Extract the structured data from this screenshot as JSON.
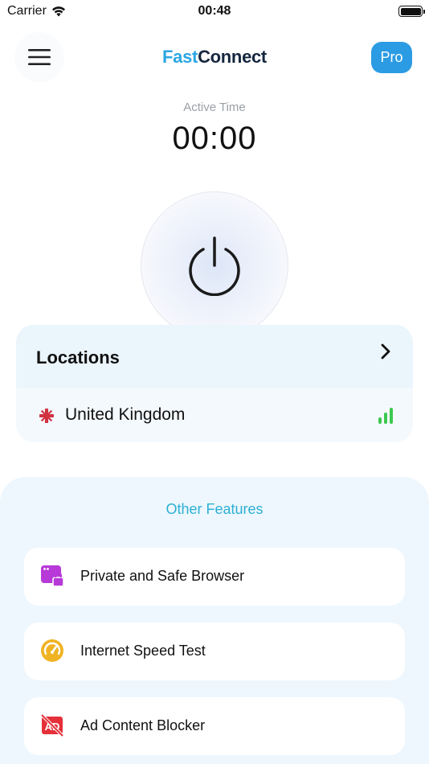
{
  "status_bar": {
    "carrier": "Carrier",
    "time": "00:48"
  },
  "header": {
    "brand_part1": "Fast",
    "brand_part2": "Connect",
    "pro_label": "Pro"
  },
  "timer": {
    "label": "Active Time",
    "value": "00:00"
  },
  "locations": {
    "title": "Locations",
    "selected": "United Kingdom",
    "signal_bars": 3
  },
  "features": {
    "title": "Other Features",
    "items": [
      {
        "label": "Private and Safe Browser",
        "icon": "private-browser-icon",
        "color": "#b73ad8"
      },
      {
        "label": "Internet Speed Test",
        "icon": "speedometer-icon",
        "color": "#f0b323"
      },
      {
        "label": "Ad Content Blocker",
        "icon": "ad-block-icon",
        "color": "#e5303a"
      }
    ]
  },
  "colors": {
    "accent": "#2b9be4",
    "brand_blue": "#2aa6e2",
    "brand_dark": "#15263f",
    "signal": "#3cc84f",
    "features_title": "#2cb0d4"
  }
}
